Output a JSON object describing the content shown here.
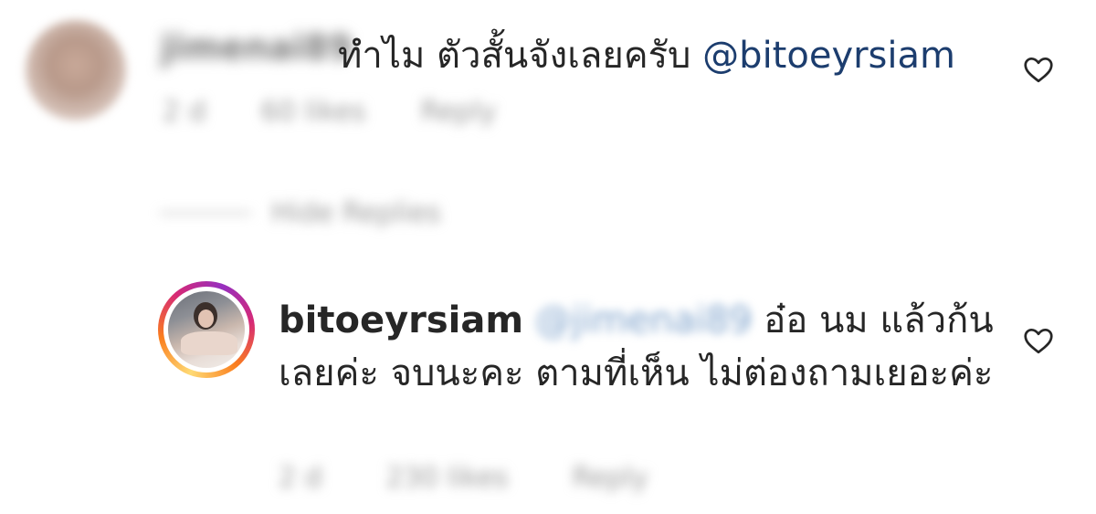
{
  "comment1": {
    "username": "jimenai89",
    "text": "ทำไม ตัวสั้นจังเลยครับ ",
    "mention": "@bitoeyrsiam",
    "meta": {
      "time": "2 d",
      "likes": "60 likes",
      "reply": "Reply"
    }
  },
  "hide_replies": "Hide Replies",
  "comment2": {
    "username": "bitoeyrsiam",
    "mention": "@jimenai89",
    "text": "อ๋อ นม แล้วก้นเลยค่ะ จบนะคะ ตามที่เห็น ไม่ต่องถามเยอะค่ะ",
    "meta": {
      "time": "2 d",
      "likes": "230 likes",
      "reply": "Reply"
    }
  }
}
